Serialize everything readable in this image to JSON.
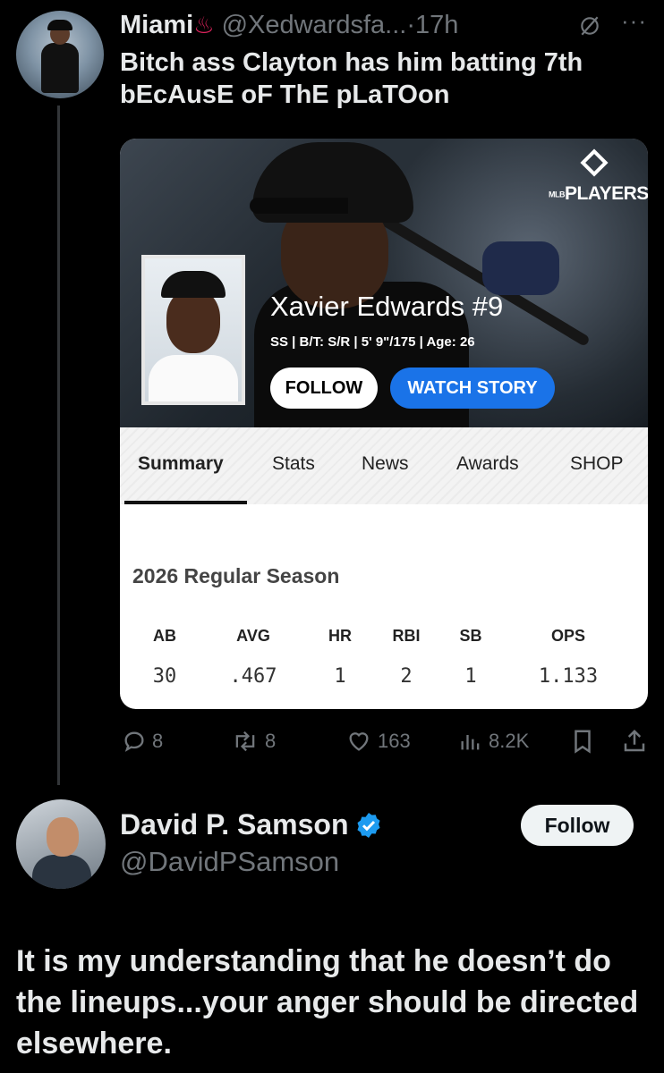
{
  "tweet": {
    "author_name": "Miami",
    "hot_emoji": "♨",
    "handle": "@Xedwardsfa...",
    "separator": "·",
    "time": "17h",
    "more": "···",
    "text": "Bitch ass Clayton has him batting 7th bEcAusE oF ThE pLaTOon",
    "icons": {
      "grok": "grok-icon",
      "more": "more-icon"
    }
  },
  "card": {
    "brand": "PLAYERS",
    "brand_small": "MLB",
    "player_name": "Xavier Edwards #9",
    "player_info": "SS | B/T: S/R | 5' 9\"/175 | Age: 26",
    "follow_label": "FOLLOW",
    "watch_label": "WATCH STORY",
    "tabs": [
      "Summary",
      "Stats",
      "News",
      "Awards",
      "SHOP"
    ],
    "active_tab": "Summary",
    "season_title": "2026 Regular Season",
    "stats_headers": [
      "AB",
      "AVG",
      "HR",
      "RBI",
      "SB",
      "OPS"
    ],
    "stats_values": [
      "30",
      ".467",
      "1",
      "2",
      "1",
      "1.133"
    ],
    "colors": {
      "watch_button": "#1a73e8"
    }
  },
  "actions": {
    "replies": "8",
    "reposts": "8",
    "likes": "163",
    "views": "8.2K"
  },
  "reply": {
    "author_name": "David P. Samson",
    "handle": "@DavidPSamson",
    "follow_label": "Follow",
    "text": "It is my understanding that he doesn’t do the lineups...your anger should be directed elsewhere.",
    "verified_color": "#1d9bf0"
  }
}
